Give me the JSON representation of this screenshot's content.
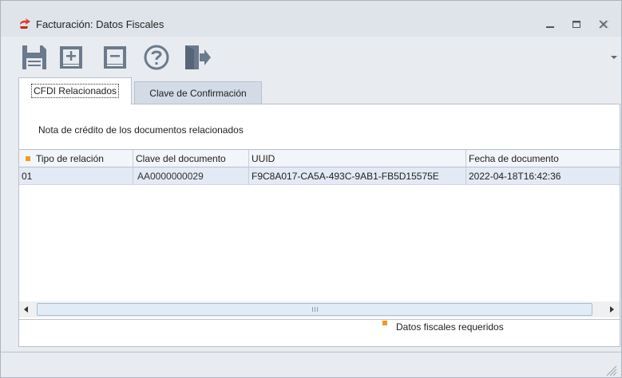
{
  "window": {
    "title": "Facturación: Datos Fiscales",
    "icon": "app-icon"
  },
  "toolbar": {
    "buttons": [
      {
        "name": "save",
        "icon": "save-icon"
      },
      {
        "name": "add-row",
        "icon": "add-row-icon"
      },
      {
        "name": "remove-row",
        "icon": "remove-row-icon"
      },
      {
        "name": "help",
        "icon": "help-icon"
      },
      {
        "name": "exit",
        "icon": "exit-icon"
      }
    ]
  },
  "tabs": [
    {
      "label": "CFDI Relacionados",
      "active": true
    },
    {
      "label": "Clave de Confirmación",
      "active": false
    }
  ],
  "panel": {
    "note": "Nota de crédito de los documentos relacionados"
  },
  "grid": {
    "columns": [
      "Tipo de relación",
      "Clave del documento",
      "UUID",
      "Fecha de documento"
    ],
    "rows": [
      [
        "01",
        "AA0000000029",
        "F9C8A017-CA5A-493C-9AB1-FB5D15575E",
        "2022-04-18T16:42:36"
      ]
    ]
  },
  "legend": {
    "text": "Datos fiscales requeridos"
  },
  "colors": {
    "required_marker": "#f59a1b",
    "selected_row": "#e3eaf5",
    "toolbar_icon": "#6b7a8c",
    "titlebar": "#dfe4ea"
  }
}
